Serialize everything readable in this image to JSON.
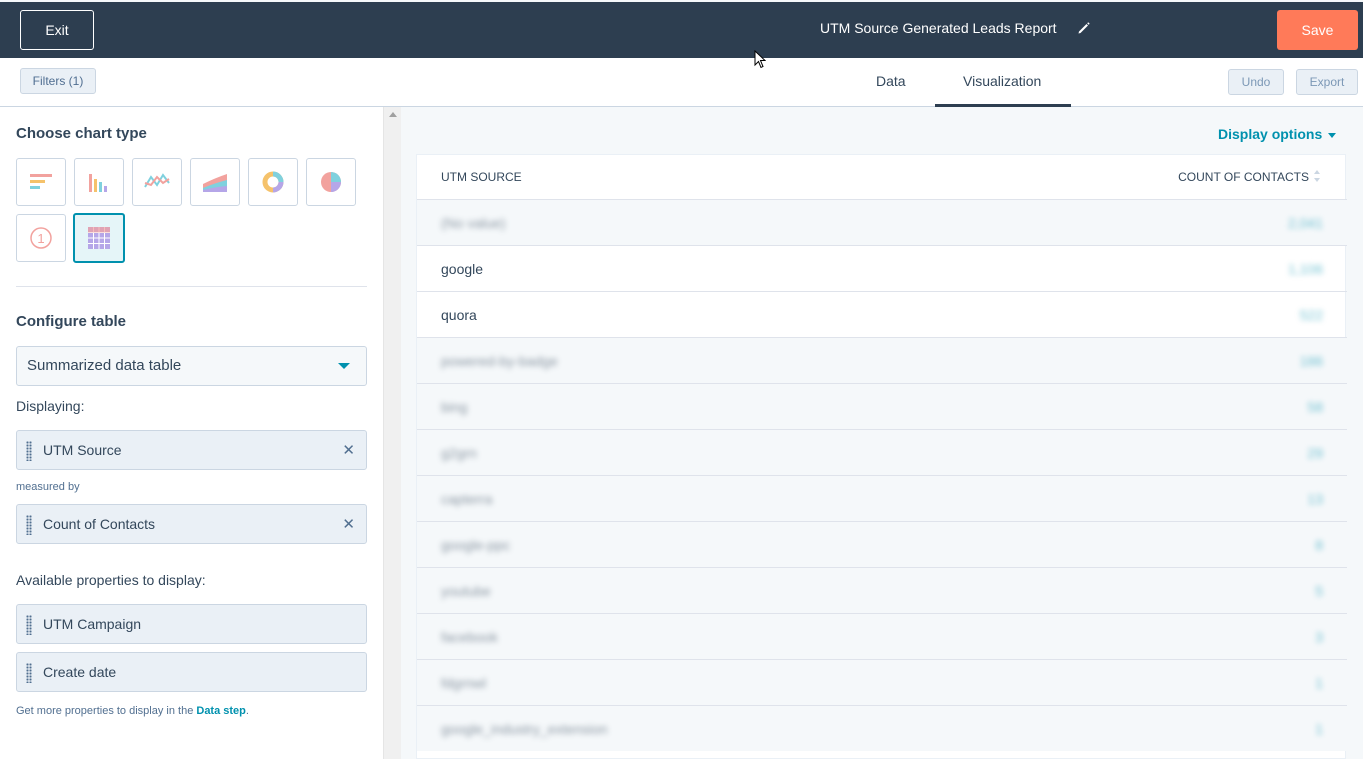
{
  "header": {
    "exit_label": "Exit",
    "report_title": "UTM Source Generated Leads Report",
    "save_label": "Save"
  },
  "toolbar": {
    "filters_label": "Filters (1)",
    "tabs": [
      {
        "label": "Data",
        "active": false
      },
      {
        "label": "Visualization",
        "active": true
      }
    ],
    "undo_label": "Undo",
    "export_label": "Export"
  },
  "left_panel": {
    "chart_type_heading": "Choose chart type",
    "chart_types": [
      {
        "icon": "horizontal-bar-chart-icon"
      },
      {
        "icon": "vertical-bar-chart-icon"
      },
      {
        "icon": "line-chart-icon"
      },
      {
        "icon": "area-chart-icon"
      },
      {
        "icon": "donut-chart-icon"
      },
      {
        "icon": "pie-chart-icon"
      },
      {
        "icon": "summary-number-icon",
        "glyph": "1"
      },
      {
        "icon": "table-chart-icon",
        "active": true
      }
    ],
    "configure_heading": "Configure table",
    "table_type": "Summarized data table",
    "displaying_label": "Displaying:",
    "displaying_chip": "UTM Source",
    "measured_by_label": "measured by",
    "measure_chip": "Count of Contacts",
    "available_label": "Available properties to display:",
    "available": [
      "UTM Campaign",
      "Create date"
    ],
    "help_text": "Get more properties to display in the",
    "help_link": "Data step",
    "help_end": "."
  },
  "right_panel": {
    "display_options_label": "Display options",
    "table": {
      "columns": [
        "UTM SOURCE",
        "COUNT OF CONTACTS"
      ],
      "rows": [
        {
          "source": "(No value)",
          "count": "2,041",
          "blurred": true
        },
        {
          "source": "google",
          "count": "1,106",
          "blurred": false,
          "count_blurred": true
        },
        {
          "source": "quora",
          "count": "522",
          "blurred": false,
          "count_blurred": true
        },
        {
          "source": "powered-by-badge",
          "count": "186",
          "blurred": true
        },
        {
          "source": "bing",
          "count": "58",
          "blurred": true
        },
        {
          "source": "g2grn",
          "count": "29",
          "blurred": true
        },
        {
          "source": "capterra",
          "count": "13",
          "blurred": true
        },
        {
          "source": "google-ppc",
          "count": "8",
          "blurred": true
        },
        {
          "source": "youtube",
          "count": "5",
          "blurred": true
        },
        {
          "source": "facebook",
          "count": "3",
          "blurred": true
        },
        {
          "source": "fdgrnwl",
          "count": "1",
          "blurred": true
        },
        {
          "source": "google_industry_extension",
          "count": "1",
          "blurred": true
        }
      ]
    }
  },
  "colors": {
    "header_bg": "#2d3e50",
    "save_orange": "#ff7a59",
    "accent_teal": "#0091ae"
  }
}
